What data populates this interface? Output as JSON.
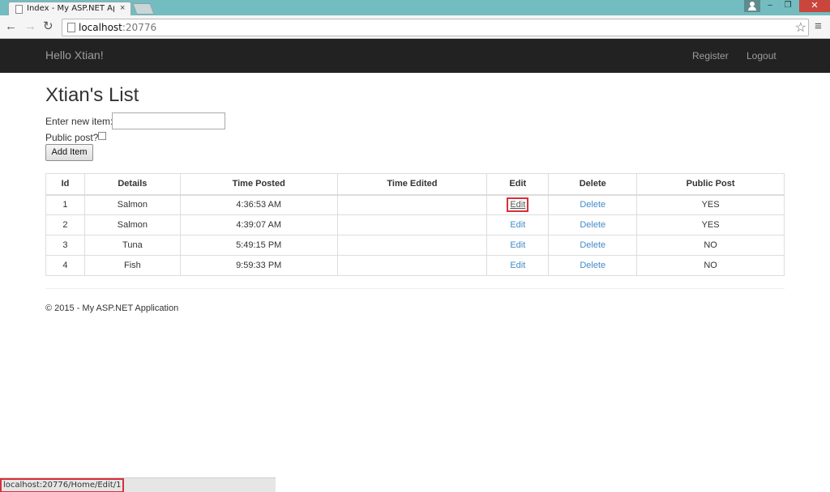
{
  "browser": {
    "tab_title": "Index - My ASP.NET Appli",
    "tab_close": "×",
    "back_icon": "←",
    "forward_icon": "→",
    "reload_icon": "↻",
    "url_host": "localhost",
    "url_port": ":20776",
    "star_icon": "☆",
    "menu_icon": "≡",
    "window_minimize": "‒",
    "window_maximize": "❐",
    "window_close": "✕",
    "status_url": "localhost:20776/Home/Edit/1"
  },
  "navbar": {
    "brand": "Hello Xtian!",
    "register": "Register",
    "logout": "Logout",
    "background_color": "#222222"
  },
  "page": {
    "title": "Xtian's List",
    "new_item_label": "Enter new item:",
    "new_item_value": "",
    "public_label": "Public post?",
    "public_checked": false,
    "add_button": "Add Item"
  },
  "table": {
    "headers": [
      "Id",
      "Details",
      "Time Posted",
      "Time Edited",
      "Edit",
      "Delete",
      "Public Post"
    ],
    "rows": [
      {
        "id": "1",
        "details": "Salmon",
        "time_posted": "4:36:53 AM",
        "time_edited": "",
        "edit": "Edit",
        "delete": "Delete",
        "public": "YES"
      },
      {
        "id": "2",
        "details": "Salmon",
        "time_posted": "4:39:07 AM",
        "time_edited": "",
        "edit": "Edit",
        "delete": "Delete",
        "public": "YES"
      },
      {
        "id": "3",
        "details": "Tuna",
        "time_posted": "5:49:15 PM",
        "time_edited": "",
        "edit": "Edit",
        "delete": "Delete",
        "public": "NO"
      },
      {
        "id": "4",
        "details": "Fish",
        "time_posted": "9:59:33 PM",
        "time_edited": "",
        "edit": "Edit",
        "delete": "Delete",
        "public": "NO"
      }
    ]
  },
  "footer": {
    "text": "© 2015 - My ASP.NET Application"
  },
  "colors": {
    "link": "#428bca",
    "highlight": "#d9303a",
    "titlebar": "#73bcc0"
  }
}
